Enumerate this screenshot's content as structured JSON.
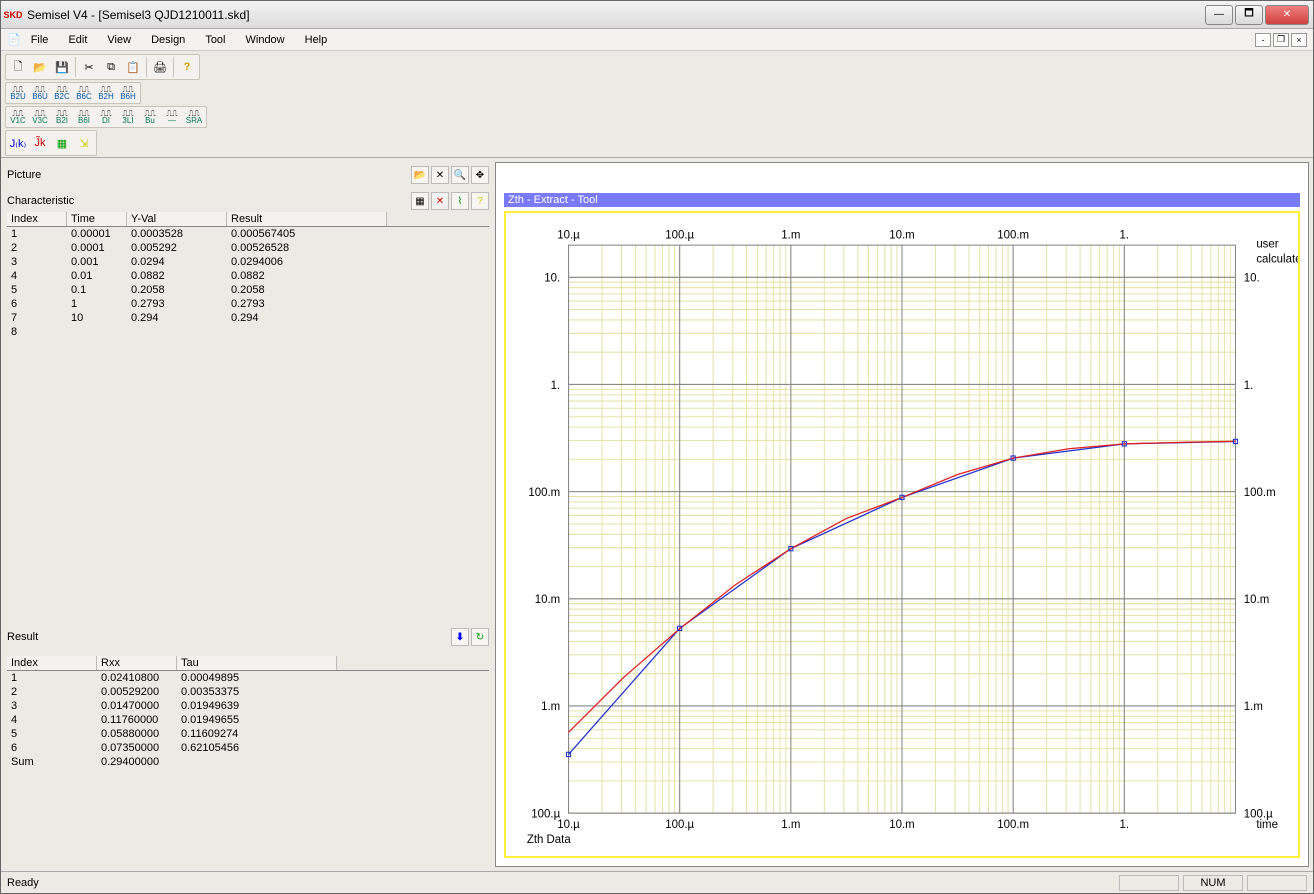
{
  "app": {
    "title": "Semisel V4 - [Semisel3 QJD1210011.skd]"
  },
  "menus": [
    "File",
    "Edit",
    "View",
    "Design",
    "Tool",
    "Window",
    "Help"
  ],
  "sections": {
    "picture": "Picture",
    "characteristic": "Characteristic",
    "result": "Result"
  },
  "char_table": {
    "headers": {
      "index": "Index",
      "time": "Time",
      "yval": "Y-Val",
      "result": "Result"
    },
    "rows": [
      {
        "idx": "1",
        "time": "0.00001",
        "yval": "0.0003528",
        "result": "0.000567405"
      },
      {
        "idx": "2",
        "time": "0.0001",
        "yval": "0.005292",
        "result": "0.00526528"
      },
      {
        "idx": "3",
        "time": "0.001",
        "yval": "0.0294",
        "result": "0.0294006"
      },
      {
        "idx": "4",
        "time": "0.01",
        "yval": "0.0882",
        "result": "0.0882"
      },
      {
        "idx": "5",
        "time": "0.1",
        "yval": "0.2058",
        "result": "0.2058"
      },
      {
        "idx": "6",
        "time": "1",
        "yval": "0.2793",
        "result": "0.2793"
      },
      {
        "idx": "7",
        "time": "10",
        "yval": "0.294",
        "result": "0.294"
      },
      {
        "idx": "8",
        "time": "",
        "yval": "",
        "result": ""
      }
    ]
  },
  "result_table": {
    "headers": {
      "index": "Index",
      "rxx": "Rxx",
      "tau": "Tau"
    },
    "rows": [
      {
        "idx": "1",
        "rxx": "0.02410800",
        "tau": "0.00049895"
      },
      {
        "idx": "2",
        "rxx": "0.00529200",
        "tau": "0.00353375"
      },
      {
        "idx": "3",
        "rxx": "0.01470000",
        "tau": "0.01949639"
      },
      {
        "idx": "4",
        "rxx": "0.11760000",
        "tau": "0.01949655"
      },
      {
        "idx": "5",
        "rxx": "0.05880000",
        "tau": "0.11609274"
      },
      {
        "idx": "6",
        "rxx": "0.07350000",
        "tau": "0.62105456"
      },
      {
        "idx": "Sum",
        "rxx": "0.29400000",
        "tau": ""
      }
    ]
  },
  "chart": {
    "title": "Zth - Extract - Tool",
    "footer": "Zth Data",
    "xaxis_label": "time",
    "legend": {
      "user": "user",
      "calculated": "calculated"
    },
    "ticks": [
      "10.µ",
      "100.µ",
      "1.m",
      "10.m",
      "100.m",
      "1."
    ],
    "yticks": [
      "10.",
      "1.",
      "100.m",
      "10.m",
      "1.m",
      "100.µ"
    ]
  },
  "chart_data": {
    "type": "line",
    "xscale": "log",
    "yscale": "log",
    "xlim_exp": [
      -5,
      1
    ],
    "ylim_exp": [
      -4,
      1.3
    ],
    "series": [
      {
        "name": "user",
        "color": "#2030d0",
        "points_logxy": [
          [
            -5,
            -3.452
          ],
          [
            -4,
            -2.276
          ],
          [
            -3,
            -1.532
          ],
          [
            -2,
            -1.054
          ],
          [
            -1,
            -0.687
          ],
          [
            0,
            -0.554
          ],
          [
            1,
            -0.532
          ]
        ]
      },
      {
        "name": "calculated",
        "color": "#e02020",
        "points_logxy": [
          [
            -5,
            -3.246
          ],
          [
            -4.5,
            -2.73
          ],
          [
            -4,
            -2.279
          ],
          [
            -3.5,
            -1.87
          ],
          [
            -3,
            -1.532
          ],
          [
            -2.5,
            -1.25
          ],
          [
            -2,
            -1.054
          ],
          [
            -1.5,
            -0.84
          ],
          [
            -1,
            -0.687
          ],
          [
            -0.5,
            -0.6
          ],
          [
            0,
            -0.554
          ],
          [
            0.5,
            -0.54
          ],
          [
            1,
            -0.53
          ]
        ]
      }
    ]
  },
  "status": {
    "left": "Ready",
    "num": "NUM"
  },
  "toolbar_row3": [
    "B2U",
    "B6U",
    "B2C",
    "B6C",
    "B2H",
    "B6H"
  ],
  "toolbar_row4": [
    "V1C",
    "V3C",
    "B2I",
    "B6I",
    "DI",
    "3LI",
    "Bu",
    "—",
    "SRA"
  ]
}
